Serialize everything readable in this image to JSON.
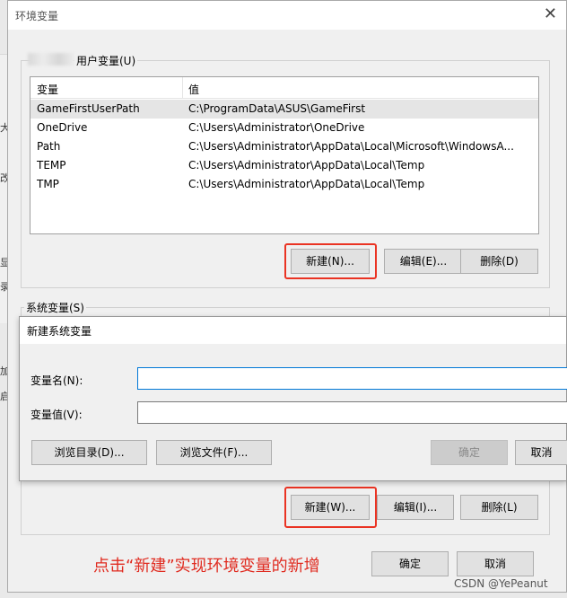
{
  "background": {
    "chars": [
      "大",
      "改",
      "显",
      "录",
      "加",
      "启"
    ]
  },
  "main_window": {
    "title": "环境变量",
    "close_glyph": "✕"
  },
  "user_group": {
    "label": "用户变量(U)"
  },
  "user_table": {
    "columns": [
      "变量",
      "值"
    ],
    "rows": [
      {
        "name": "GameFirstUserPath",
        "value": "C:\\ProgramData\\ASUS\\GameFirst"
      },
      {
        "name": "OneDrive",
        "value": "C:\\Users\\Administrator\\OneDrive"
      },
      {
        "name": "Path",
        "value": "C:\\Users\\Administrator\\AppData\\Local\\Microsoft\\WindowsA..."
      },
      {
        "name": "TEMP",
        "value": "C:\\Users\\Administrator\\AppData\\Local\\Temp"
      },
      {
        "name": "TMP",
        "value": "C:\\Users\\Administrator\\AppData\\Local\\Temp"
      }
    ]
  },
  "user_buttons": {
    "new": "新建(N)...",
    "edit": "编辑(E)...",
    "delete": "删除(D)"
  },
  "system_group": {
    "label": "系统变量(S)"
  },
  "dialog": {
    "title": "新建系统变量",
    "name_label": "变量名(N):",
    "value_label": "变量值(V):",
    "name_value": "",
    "value_value": "",
    "browse_dir": "浏览目录(D)...",
    "browse_file": "浏览文件(F)...",
    "ok": "确定",
    "cancel": "取消"
  },
  "system_buttons": {
    "new": "新建(W)...",
    "edit": "编辑(I)...",
    "delete": "删除(L)"
  },
  "footer_buttons": {
    "ok": "确定",
    "cancel": "取消"
  },
  "annotation": "点击“新建”实现环境变量的新增",
  "watermark": "CSDN @YePeanut",
  "colors": {
    "highlight": "#ea3323",
    "annotation": "#e02b20",
    "focus": "#0078d7"
  }
}
